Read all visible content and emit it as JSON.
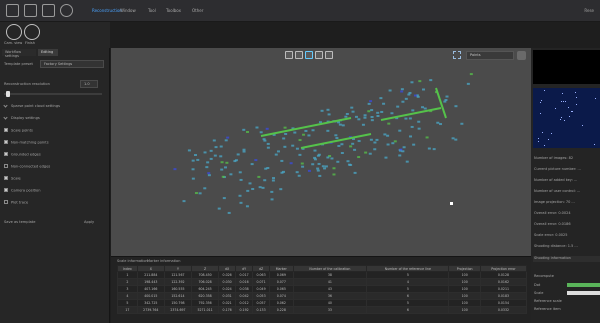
{
  "menubar": {
    "menus": [
      "Reconstruction",
      "Window",
      "Tool",
      "Toolbox",
      "Other"
    ],
    "active_index": 0,
    "right_text": "Rese"
  },
  "toolbar": {
    "buttons": [
      {
        "label": "Cam. view",
        "icon": "play-icon"
      },
      {
        "label": "Finish",
        "icon": "check-icon"
      }
    ]
  },
  "left_panel": {
    "tabs": [
      "Workflow settings",
      "Editing"
    ],
    "active_tab": 1,
    "template_label": "Template preset",
    "template_value": "Factory Settings",
    "resolution_label": "Reconstruction resolution",
    "resolution_value": "1.0",
    "slider_value": 0.05,
    "section_sparse": "Sparse point cloud settings",
    "section_display": "Display settings",
    "checkboxes": [
      {
        "label": "Scale points",
        "checked": true
      },
      {
        "label": "Non-matching points",
        "checked": true
      },
      {
        "label": "Grounded edges",
        "checked": true
      },
      {
        "label": "Non-connected edges",
        "checked": false
      },
      {
        "label": "Scale",
        "checked": true
      },
      {
        "label": "Camera position",
        "checked": true
      },
      {
        "label": "Plot trace",
        "checked": false
      }
    ],
    "save_label": "Save as template",
    "apply_label": "Apply"
  },
  "viewport": {
    "view_select": "Points",
    "tool_icons": [
      "rotate-icon",
      "pan-icon",
      "zoom-icon",
      "select-icon",
      "measure-icon"
    ]
  },
  "bottom": {
    "tabs": [
      "Scale information",
      "Marker information"
    ],
    "columns": [
      "Index",
      "X",
      "Y",
      "Z",
      "dX",
      "dY",
      "dZ",
      "Marker",
      "Number of the calibration",
      "Number of the reference line",
      "Projection",
      "Projection error"
    ],
    "rows": [
      [
        "1",
        "211.884",
        "121.567",
        "708.450",
        "0.026",
        "0.017",
        "0.063",
        "0.069",
        "38",
        "5",
        "100",
        "0.0128"
      ],
      [
        "2",
        "198.443",
        "122.392",
        "706.028",
        "0.030",
        "0.016",
        "0.071",
        "0.077",
        "41",
        "4",
        "100",
        "0.0162"
      ],
      [
        "3",
        "407.166",
        "160.555",
        "604.245",
        "0.024",
        "0.038",
        "0.049",
        "0.065",
        "43",
        "5",
        "100",
        "0.0211"
      ],
      [
        "4",
        "400.015",
        "152.614",
        "620.358",
        "0.031",
        "0.042",
        "0.053",
        "0.074",
        "36",
        "6",
        "100",
        "0.0183"
      ],
      [
        "5",
        "342.725",
        "150.798",
        "792.356",
        "0.021",
        "0.012",
        "0.057",
        "0.062",
        "40",
        "5",
        "100",
        "0.0154"
      ],
      [
        "17",
        "2739.764",
        "2374.697",
        "5271.011",
        "0.176",
        "0.192",
        "0.133",
        "0.228",
        "33",
        "6",
        "100",
        "0.0332"
      ]
    ]
  },
  "right_panel": {
    "info_lines": [
      "Number of images: 82",
      "Current picture number: ...",
      "Number of added key: ...",
      "Number of user control: ...",
      "Image projection: 70 ...",
      "Overall error: 0.0024",
      "Overall error: 0.0186",
      "Scale error: 0.0025",
      "Shooting distance: 1.5 ..."
    ],
    "section1": "Shooting information",
    "section2": "Recompute",
    "color_rows": [
      "Dot",
      "Scale",
      "Reference scale",
      "Reference item"
    ],
    "accent": "#5ab45a"
  },
  "colors": {
    "accent": "#4aa3ff",
    "green": "#55c24a",
    "blue_point": "#3a4be0",
    "cyan_point": "#4aa8c8"
  }
}
